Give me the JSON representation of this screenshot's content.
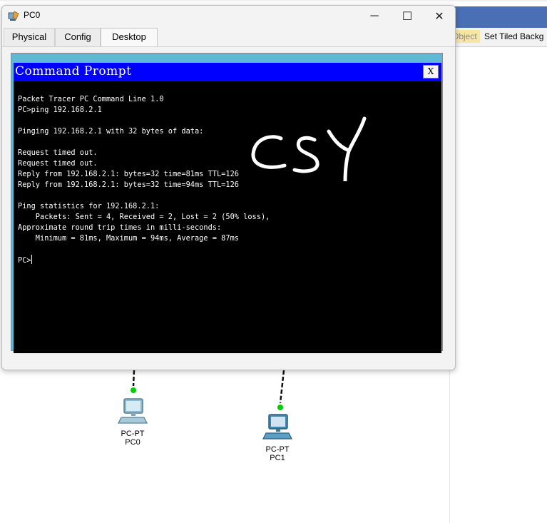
{
  "window": {
    "title": "PC0",
    "minimize_glyph": "─",
    "maximize_glyph": "☐",
    "close_glyph": "✕"
  },
  "tabs": [
    {
      "label": "Physical",
      "active": false
    },
    {
      "label": "Config",
      "active": false
    },
    {
      "label": "Desktop",
      "active": true
    }
  ],
  "command_prompt": {
    "title": "Command Prompt",
    "close_label": "X",
    "lines": [
      "Packet Tracer PC Command Line 1.0",
      "PC>ping 192.168.2.1",
      "",
      "Pinging 192.168.2.1 with 32 bytes of data:",
      "",
      "Request timed out.",
      "Request timed out.",
      "Reply from 192.168.2.1: bytes=32 time=81ms TTL=126",
      "Reply from 192.168.2.1: bytes=32 time=94ms TTL=126",
      "",
      "Ping statistics for 192.168.2.1:",
      "    Packets: Sent = 4, Received = 2, Lost = 2 (50% loss),",
      "Approximate round trip times in milli-seconds:",
      "    Minimum = 81ms, Maximum = 94ms, Average = 87ms",
      "",
      "PC>"
    ],
    "handwritten_signature": "CSY"
  },
  "background_app": {
    "object_label": "Object",
    "tile_label": "Set Tiled Backg"
  },
  "devices": [
    {
      "type": "PC-PT",
      "name": "PC0"
    },
    {
      "type": "PC-PT",
      "name": "PC1"
    }
  ],
  "colors": {
    "cmd_titlebar": "#0000ff",
    "desktop_bg": "#5fb8d6",
    "link_up": "#00cc00"
  }
}
